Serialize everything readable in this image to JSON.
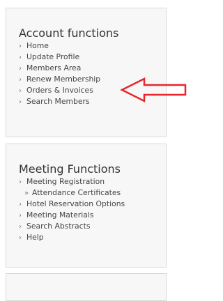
{
  "account": {
    "title": "Account functions",
    "items": [
      {
        "bullet": "›",
        "label": "Home"
      },
      {
        "bullet": "›",
        "label": "Update Profile"
      },
      {
        "bullet": "›",
        "label": "Members Area"
      },
      {
        "bullet": "›",
        "label": "Renew Membership"
      },
      {
        "bullet": "›",
        "label": "Orders & Invoices"
      },
      {
        "bullet": "›",
        "label": "Search Members"
      }
    ]
  },
  "meeting": {
    "title": "Meeting Functions",
    "items": [
      {
        "bullet": "›",
        "label": "Meeting Registration"
      },
      {
        "bullet": "»",
        "label": "Attendance Certificates"
      },
      {
        "bullet": "›",
        "label": "Hotel Reservation Options"
      },
      {
        "bullet": "›",
        "label": "Meeting Materials"
      },
      {
        "bullet": "›",
        "label": "Search Abstracts"
      },
      {
        "bullet": "›",
        "label": "Help"
      }
    ]
  },
  "colors": {
    "panel_bg": "#f7f7f7",
    "panel_border": "#d9d9d9",
    "arrow": "#e8262c"
  },
  "annotation": {
    "icon": "left-arrow-icon"
  }
}
